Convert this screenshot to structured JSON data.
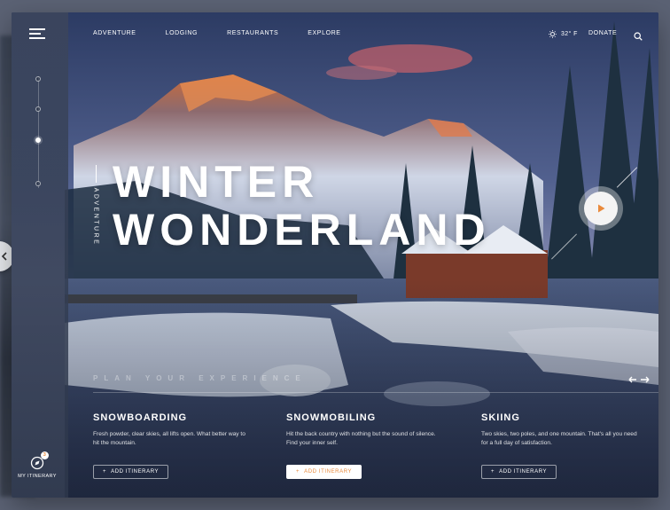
{
  "nav": {
    "items": [
      "ADVENTURE",
      "LODGING",
      "RESTAURANTS",
      "EXPLORE"
    ],
    "temperature": "32° F",
    "donate": "DONATE"
  },
  "hero": {
    "vertical_label": "ADVENTURE",
    "title_line1": "WINTER",
    "title_line2": "WONDERLAND",
    "tagline": "PLAN YOUR EXPERIENCE"
  },
  "activities": [
    {
      "title": "SNOWBOARDING",
      "description": "Fresh powder, clear skies, all lifts open. What better way to hit the mountain.",
      "button": "ADD ITINERARY",
      "button_style": "outline"
    },
    {
      "title": "SNOWMOBILING",
      "description": "Hit the back country with nothing but the sound of silence. Find your inner self.",
      "button": "ADD ITINERARY",
      "button_style": "primary"
    },
    {
      "title": "SKIING",
      "description": "Two skies, two poles, and one mountain. That's all you need for a full day of satisfaction.",
      "button": "ADD ITINERARY",
      "button_style": "outline"
    }
  ],
  "itinerary": {
    "label": "MY ITINERARY",
    "count": "3"
  },
  "colors": {
    "accent": "#e98a3c",
    "background": "#5b6274",
    "sidebar": "#3c465c"
  },
  "icons": {
    "menu": "hamburger-icon",
    "weather": "sun-icon",
    "search": "search-icon",
    "play": "play-icon",
    "back": "chevron-left-icon",
    "slider": "arrows-icon",
    "itinerary": "compass-icon"
  }
}
